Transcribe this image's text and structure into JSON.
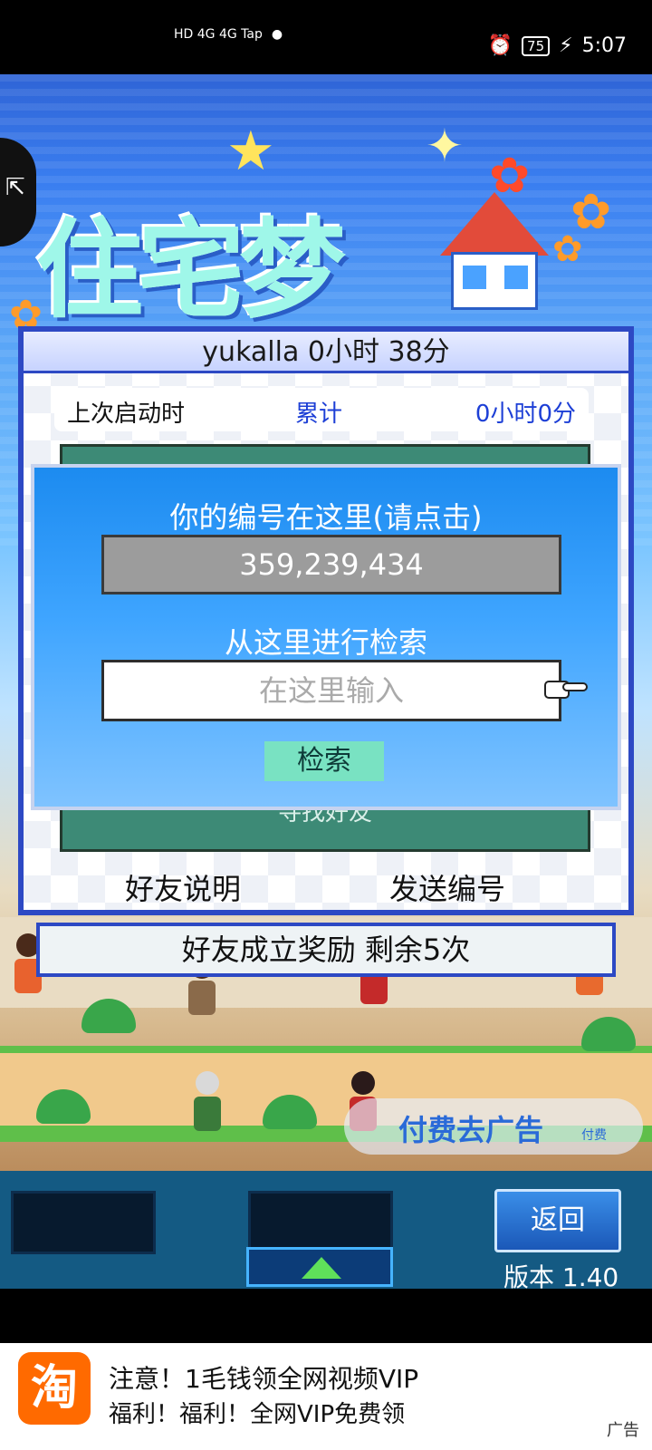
{
  "status_bar": {
    "signal_text": "HD 4G 4G Tap",
    "battery": "75",
    "time": "5:07"
  },
  "game": {
    "logo": "住宅梦",
    "dialog_title": "yukalla  0小时 38分",
    "last_launch_label": "上次启动时",
    "total_label": "累计",
    "total_value": "0小时0分",
    "find_friends": "寻找好友",
    "friend_help": "好友说明",
    "send_id": "发送编号",
    "reward_bar": "好友成立奖励  剩余5次"
  },
  "popup": {
    "id_title": "你的编号在这里(请点击)",
    "id_value": "359,239,434",
    "search_title": "从这里进行检索",
    "input_placeholder": "在这里输入",
    "search_button": "检索"
  },
  "ad_pill": {
    "label": "付费去广告",
    "small": "付费"
  },
  "controls": {
    "back": "返回",
    "version": "版本 1.40"
  },
  "ad_banner": {
    "icon": "淘",
    "line1": "注意！1毛钱领全网视频VIP",
    "line2": "福利！福利！全网VIP免费领",
    "tag": "广告"
  }
}
